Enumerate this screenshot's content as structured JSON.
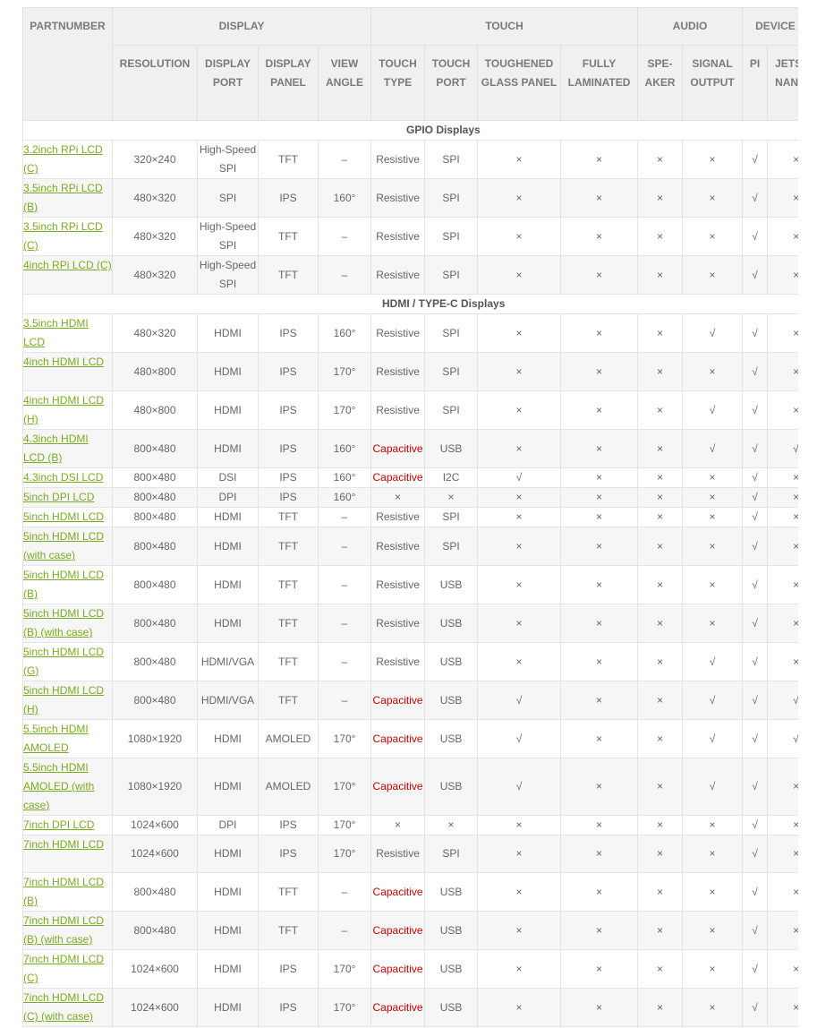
{
  "headers": {
    "partnumber": "PARTNUMBER",
    "groups": {
      "display": "DISPLAY",
      "touch": "TOUCH",
      "audio": "AUDIO",
      "device": "DEVICE"
    },
    "cols": {
      "resolution": "RESOLUTION",
      "display_port": "DISPLAY PORT",
      "display_panel": "DISPLAY PANEL",
      "view_angle": "VIEW ANGLE",
      "touch_type": "TOUCH TYPE",
      "touch_port": "TOUCH PORT",
      "toughened": "TOUGHENED GLASS PANEL",
      "laminated": "FULLY LAMINATED",
      "speaker": "SPE- AKER",
      "signal_output": "SIGNAL OUTPUT",
      "pi": "PI",
      "jetson": "JETSON NANO"
    }
  },
  "sections": {
    "gpio": "GPIO Displays",
    "hdmi": "HDMI / TYPE-C Displays"
  },
  "gpio_rows": [
    {
      "pn": "3.2inch RPi LCD (C)",
      "res": "320×240",
      "port": "High-Speed SPI",
      "panel": "TFT",
      "angle": "–",
      "ttype": "Resistive",
      "tport": "SPI",
      "tough": "×",
      "lam": "×",
      "spk": "×",
      "sig": "×",
      "pi": "√",
      "jet": "×"
    },
    {
      "pn": "3.5inch RPi LCD (B)",
      "res": "480×320",
      "port": "SPI",
      "panel": "IPS",
      "angle": "160°",
      "ttype": "Resistive",
      "tport": "SPI",
      "tough": "×",
      "lam": "×",
      "spk": "×",
      "sig": "×",
      "pi": "√",
      "jet": "×"
    },
    {
      "pn": "3.5inch RPi LCD (C)",
      "res": "480×320",
      "port": "High-Speed SPI",
      "panel": "TFT",
      "angle": "–",
      "ttype": "Resistive",
      "tport": "SPI",
      "tough": "×",
      "lam": "×",
      "spk": "×",
      "sig": "×",
      "pi": "√",
      "jet": "×"
    },
    {
      "pn": "4inch RPi LCD (C)",
      "res": "480×320",
      "port": "High-Speed SPI",
      "panel": "TFT",
      "angle": "–",
      "ttype": "Resistive",
      "tport": "SPI",
      "tough": "×",
      "lam": "×",
      "spk": "×",
      "sig": "×",
      "pi": "√",
      "jet": "×"
    }
  ],
  "hdmi_rows": [
    {
      "pn": "3.5inch HDMI LCD",
      "res": "480×320",
      "port": "HDMI",
      "panel": "IPS",
      "angle": "160°",
      "ttype": "Resistive",
      "tport": "SPI",
      "tough": "×",
      "lam": "×",
      "spk": "×",
      "sig": "√",
      "pi": "√",
      "jet": "×"
    },
    {
      "pn": "4inch HDMI LCD",
      "res": "480×800",
      "port": "HDMI",
      "panel": "IPS",
      "angle": "170°",
      "ttype": "Resistive",
      "tport": "SPI",
      "tough": "×",
      "lam": "×",
      "spk": "×",
      "sig": "×",
      "pi": "√",
      "jet": "×"
    },
    {
      "pn": "4inch HDMI LCD (H)",
      "res": "480×800",
      "port": "HDMI",
      "panel": "IPS",
      "angle": "170°",
      "ttype": "Resistive",
      "tport": "SPI",
      "tough": "×",
      "lam": "×",
      "spk": "×",
      "sig": "√",
      "pi": "√",
      "jet": "×"
    },
    {
      "pn": "4.3inch HDMI LCD (B)",
      "res": "800×480",
      "port": "HDMI",
      "panel": "IPS",
      "angle": "160°",
      "ttype": "Capacitive",
      "tport": "USB",
      "tough": "×",
      "lam": "×",
      "spk": "×",
      "sig": "√",
      "pi": "√",
      "jet": "√"
    },
    {
      "pn": "4.3inch DSI LCD",
      "res": "800×480",
      "port": "DSI",
      "panel": "IPS",
      "angle": "160°",
      "ttype": "Capacitive",
      "tport": "I2C",
      "tough": "√",
      "lam": "×",
      "spk": "×",
      "sig": "×",
      "pi": "√",
      "jet": "×"
    },
    {
      "pn": "5inch DPI LCD",
      "res": "800×480",
      "port": "DPI",
      "panel": "IPS",
      "angle": "160°",
      "ttype": "×",
      "tport": "×",
      "tough": "×",
      "lam": "×",
      "spk": "×",
      "sig": "×",
      "pi": "√",
      "jet": "×"
    },
    {
      "pn": "5inch HDMI LCD",
      "res": "800×480",
      "port": "HDMI",
      "panel": "TFT",
      "angle": "–",
      "ttype": "Resistive",
      "tport": "SPI",
      "tough": "×",
      "lam": "×",
      "spk": "×",
      "sig": "×",
      "pi": "√",
      "jet": "×"
    },
    {
      "pn": "5inch HDMI LCD (with case)",
      "res": "800×480",
      "port": "HDMI",
      "panel": "TFT",
      "angle": "–",
      "ttype": "Resistive",
      "tport": "SPI",
      "tough": "×",
      "lam": "×",
      "spk": "×",
      "sig": "×",
      "pi": "√",
      "jet": "×"
    },
    {
      "pn": "5inch HDMI LCD (B)",
      "res": "800×480",
      "port": "HDMI",
      "panel": "TFT",
      "angle": "–",
      "ttype": "Resistive",
      "tport": "USB",
      "tough": "×",
      "lam": "×",
      "spk": "×",
      "sig": "×",
      "pi": "√",
      "jet": "×"
    },
    {
      "pn": "5inch HDMI LCD (B) (with case)",
      "res": "800×480",
      "port": "HDMI",
      "panel": "TFT",
      "angle": "–",
      "ttype": "Resistive",
      "tport": "USB",
      "tough": "×",
      "lam": "×",
      "spk": "×",
      "sig": "×",
      "pi": "√",
      "jet": "×"
    },
    {
      "pn": "5inch HDMI LCD (G)",
      "res": "800×480",
      "port": "HDMI/VGA",
      "panel": "TFT",
      "angle": "–",
      "ttype": "Resistive",
      "tport": "USB",
      "tough": "×",
      "lam": "×",
      "spk": "×",
      "sig": "√",
      "pi": "√",
      "jet": "×"
    },
    {
      "pn": "5inch HDMI LCD (H)",
      "res": "800×480",
      "port": "HDMI/VGA",
      "panel": "TFT",
      "angle": "–",
      "ttype": "Capacitive",
      "tport": "USB",
      "tough": "√",
      "lam": "×",
      "spk": "×",
      "sig": "√",
      "pi": "√",
      "jet": "√"
    },
    {
      "pn": "5.5inch HDMI AMOLED",
      "res": "1080×1920",
      "port": "HDMI",
      "panel": "AMOLED",
      "angle": "170°",
      "ttype": "Capacitive",
      "tport": "USB",
      "tough": "√",
      "lam": "×",
      "spk": "×",
      "sig": "√",
      "pi": "√",
      "jet": "√"
    },
    {
      "pn": "5.5inch HDMI AMOLED (with case)",
      "res": "1080×1920",
      "port": "HDMI",
      "panel": "AMOLED",
      "angle": "170°",
      "ttype": "Capacitive",
      "tport": "USB",
      "tough": "√",
      "lam": "×",
      "spk": "×",
      "sig": "√",
      "pi": "√",
      "jet": "×"
    },
    {
      "pn": "7inch DPI LCD",
      "res": "1024×600",
      "port": "DPI",
      "panel": "IPS",
      "angle": "170°",
      "ttype": "×",
      "tport": "×",
      "tough": "×",
      "lam": "×",
      "spk": "×",
      "sig": "×",
      "pi": "√",
      "jet": "×"
    },
    {
      "pn": "7inch HDMI LCD",
      "res": "1024×600",
      "port": "HDMI",
      "panel": "IPS",
      "angle": "170°",
      "ttype": "Resistive",
      "tport": "SPI",
      "tough": "×",
      "lam": "×",
      "spk": "×",
      "sig": "×",
      "pi": "√",
      "jet": "×"
    },
    {
      "pn": "7inch HDMI LCD (B)",
      "res": "800×480",
      "port": "HDMI",
      "panel": "TFT",
      "angle": "–",
      "ttype": "Capacitive",
      "tport": "USB",
      "tough": "×",
      "lam": "×",
      "spk": "×",
      "sig": "×",
      "pi": "√",
      "jet": "×"
    },
    {
      "pn": "7inch HDMI LCD (B) (with case)",
      "res": "800×480",
      "port": "HDMI",
      "panel": "TFT",
      "angle": "–",
      "ttype": "Capacitive",
      "tport": "USB",
      "tough": "×",
      "lam": "×",
      "spk": "×",
      "sig": "×",
      "pi": "√",
      "jet": "×"
    },
    {
      "pn": "7inch HDMI LCD (C)",
      "res": "1024×600",
      "port": "HDMI",
      "panel": "IPS",
      "angle": "170°",
      "ttype": "Capacitive",
      "tport": "USB",
      "tough": "×",
      "lam": "×",
      "spk": "×",
      "sig": "×",
      "pi": "√",
      "jet": "×"
    },
    {
      "pn": "7inch HDMI LCD (C) (with case)",
      "res": "1024×600",
      "port": "HDMI",
      "panel": "IPS",
      "angle": "170°",
      "ttype": "Capacitive",
      "tport": "USB",
      "tough": "×",
      "lam": "×",
      "spk": "×",
      "sig": "×",
      "pi": "√",
      "jet": "×"
    }
  ],
  "colors": {
    "link": "#7bab20",
    "capacitive": "#cc0000",
    "header_bg": "#f0f0f0"
  }
}
